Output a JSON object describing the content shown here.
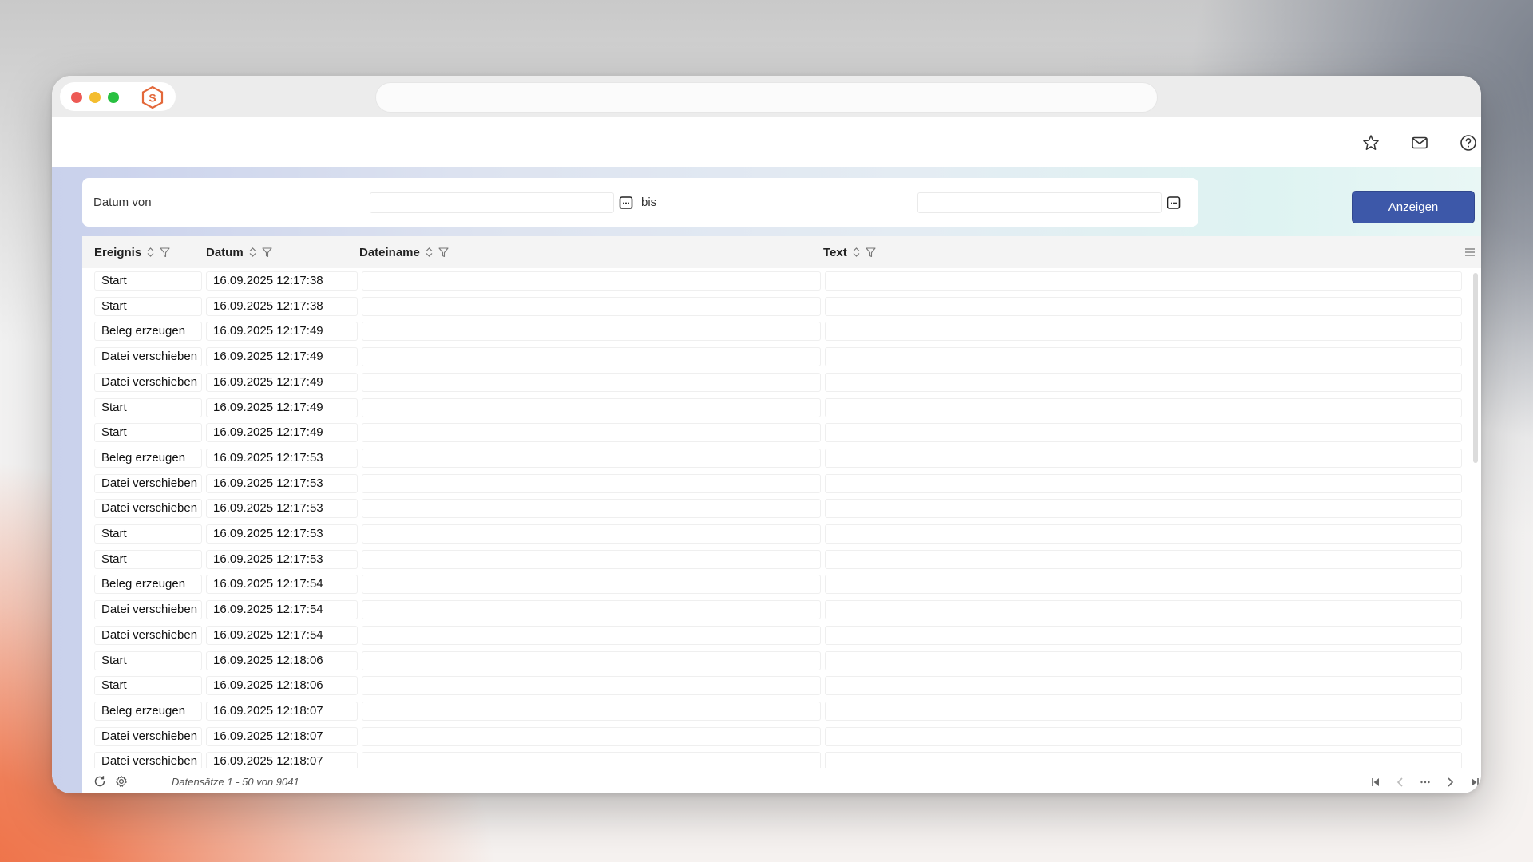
{
  "window": {
    "url": ""
  },
  "filter": {
    "from_label": "Datum von",
    "from_value": "",
    "to_label": "bis",
    "to_value": "",
    "show_button": "Anzeigen"
  },
  "table": {
    "columns": [
      "Ereignis",
      "Datum",
      "Dateiname",
      "Text"
    ],
    "rows": [
      {
        "ereignis": "Start",
        "datum": "16.09.2025 12:17:38",
        "dateiname": "",
        "text": ""
      },
      {
        "ereignis": "Start",
        "datum": "16.09.2025 12:17:38",
        "dateiname": "",
        "text": ""
      },
      {
        "ereignis": "Beleg erzeugen",
        "datum": "16.09.2025 12:17:49",
        "dateiname": "",
        "text": ""
      },
      {
        "ereignis": "Datei verschieben",
        "datum": "16.09.2025 12:17:49",
        "dateiname": "",
        "text": ""
      },
      {
        "ereignis": "Datei verschieben",
        "datum": "16.09.2025 12:17:49",
        "dateiname": "",
        "text": ""
      },
      {
        "ereignis": "Start",
        "datum": "16.09.2025 12:17:49",
        "dateiname": "",
        "text": ""
      },
      {
        "ereignis": "Start",
        "datum": "16.09.2025 12:17:49",
        "dateiname": "",
        "text": ""
      },
      {
        "ereignis": "Beleg erzeugen",
        "datum": "16.09.2025 12:17:53",
        "dateiname": "",
        "text": ""
      },
      {
        "ereignis": "Datei verschieben",
        "datum": "16.09.2025 12:17:53",
        "dateiname": "",
        "text": ""
      },
      {
        "ereignis": "Datei verschieben",
        "datum": "16.09.2025 12:17:53",
        "dateiname": "",
        "text": ""
      },
      {
        "ereignis": "Start",
        "datum": "16.09.2025 12:17:53",
        "dateiname": "",
        "text": ""
      },
      {
        "ereignis": "Start",
        "datum": "16.09.2025 12:17:53",
        "dateiname": "",
        "text": ""
      },
      {
        "ereignis": "Beleg erzeugen",
        "datum": "16.09.2025 12:17:54",
        "dateiname": "",
        "text": ""
      },
      {
        "ereignis": "Datei verschieben",
        "datum": "16.09.2025 12:17:54",
        "dateiname": "",
        "text": ""
      },
      {
        "ereignis": "Datei verschieben",
        "datum": "16.09.2025 12:17:54",
        "dateiname": "",
        "text": ""
      },
      {
        "ereignis": "Start",
        "datum": "16.09.2025 12:18:06",
        "dateiname": "",
        "text": ""
      },
      {
        "ereignis": "Start",
        "datum": "16.09.2025 12:18:06",
        "dateiname": "",
        "text": ""
      },
      {
        "ereignis": "Beleg erzeugen",
        "datum": "16.09.2025 12:18:07",
        "dateiname": "",
        "text": ""
      },
      {
        "ereignis": "Datei verschieben",
        "datum": "16.09.2025 12:18:07",
        "dateiname": "",
        "text": ""
      },
      {
        "ereignis": "Datei verschieben",
        "datum": "16.09.2025 12:18:07",
        "dateiname": "",
        "text": ""
      }
    ]
  },
  "footer": {
    "records_text": "Datensätze 1 - 50 von 9041"
  },
  "icons": {
    "app_logo": "s-hexagon-logo",
    "favorite": "star-icon",
    "mail": "mail-icon",
    "help": "help-icon"
  },
  "colors": {
    "primary_button": "#3d58a9",
    "close": "#ed5a55",
    "minimize": "#f4bd2f",
    "maximize": "#29c041",
    "logo": "#e3683a"
  }
}
